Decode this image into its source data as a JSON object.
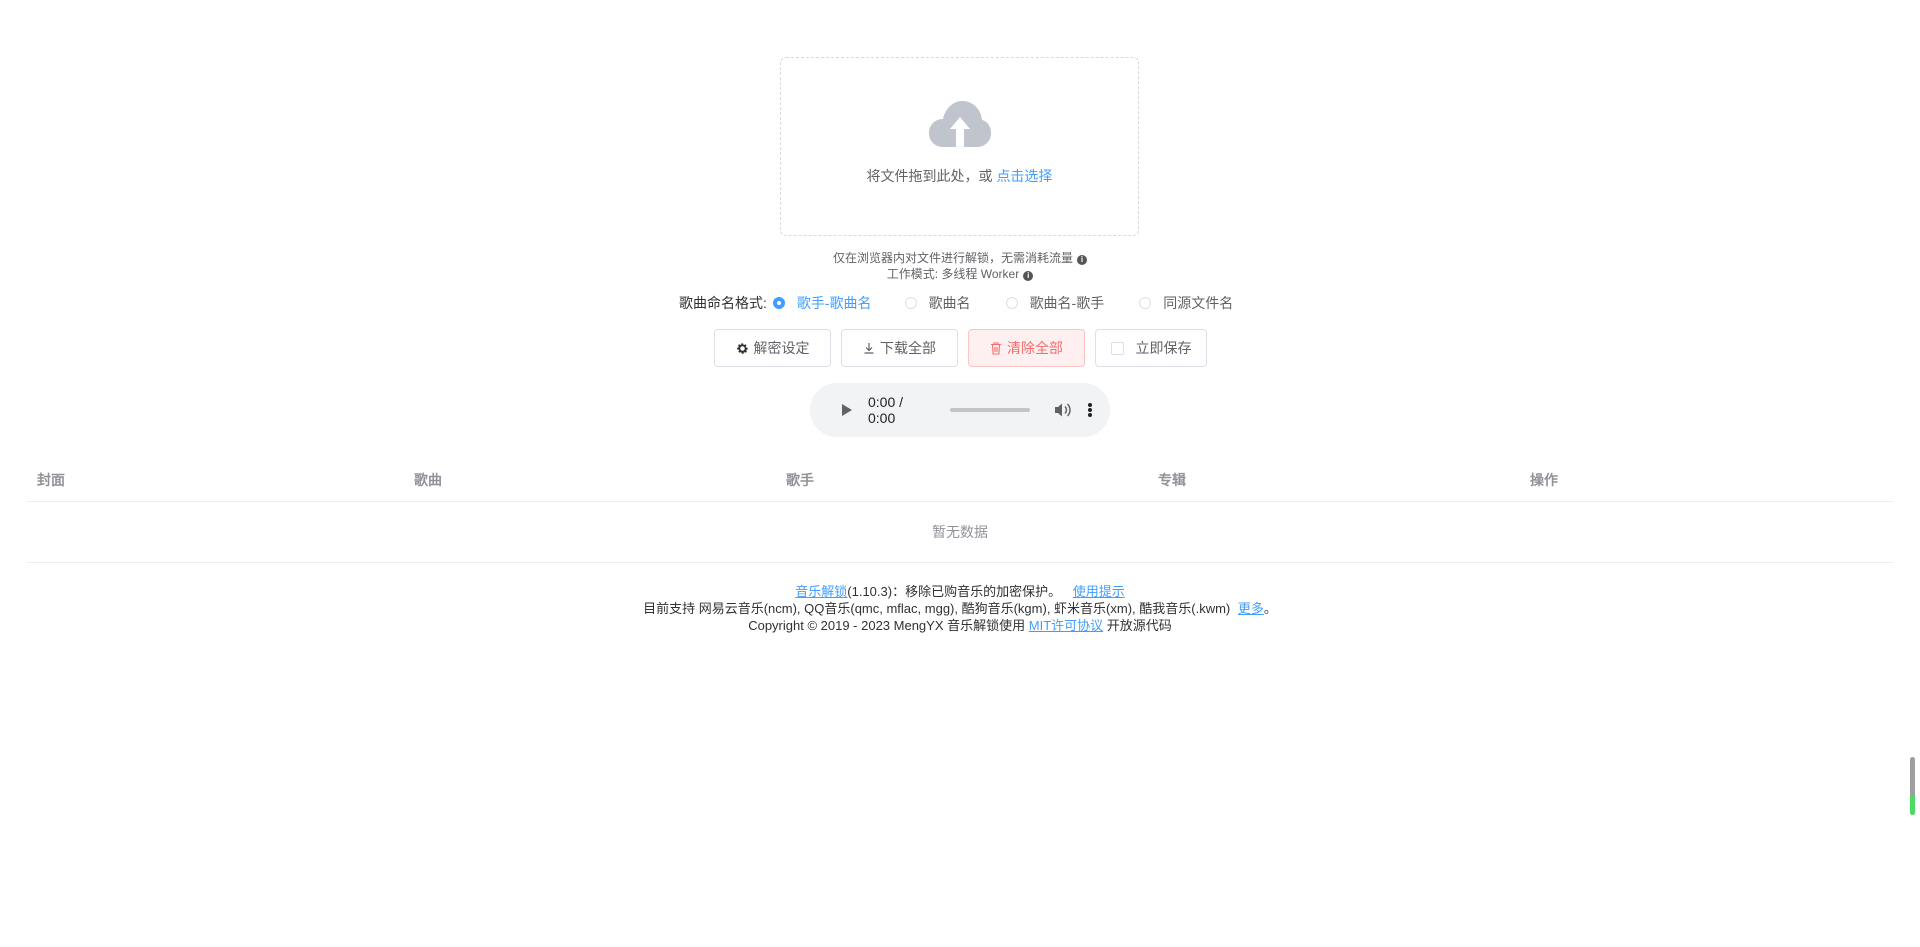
{
  "upload": {
    "text_prefix": "将文件拖到此处，或",
    "link": "点击选择"
  },
  "tips": {
    "line1": "仅在浏览器内对文件进行解锁，无需消耗流量",
    "line2": "工作模式: 多线程 Worker"
  },
  "naming": {
    "label": "歌曲命名格式:",
    "options": [
      "歌手-歌曲名",
      "歌曲名",
      "歌曲名-歌手",
      "同源文件名"
    ],
    "selected": "歌手-歌曲名"
  },
  "actions": {
    "settings": "解密设定",
    "download_all": "下载全部",
    "clear_all": "清除全部",
    "save_now": "立即保存"
  },
  "player": {
    "time": "0:00 / 0:00"
  },
  "table": {
    "columns": [
      "封面",
      "歌曲",
      "歌手",
      "专辑",
      "操作"
    ],
    "empty": "暂无数据"
  },
  "footer": {
    "app_link": "音乐解锁",
    "version_text": "(1.10.3)：移除已购音乐的加密保护。",
    "usage_link": "使用提示",
    "support_text": "目前支持 网易云音乐(ncm), QQ音乐(qmc, mflac, mgg), 酷狗音乐(kgm), 虾米音乐(xm), 酷我音乐(.kwm)",
    "more_link": "更多",
    "more_suffix": "。",
    "copyright": "Copyright © 2019 - 2023 MengYX 音乐解锁使用",
    "license_link": "MIT许可协议",
    "opensource": "开放源代码"
  },
  "colors": {
    "primary": "#409eff",
    "danger": "#f56c6c",
    "danger_bg": "#fef0f0",
    "border": "#dcdfe6",
    "text": "#606266"
  }
}
